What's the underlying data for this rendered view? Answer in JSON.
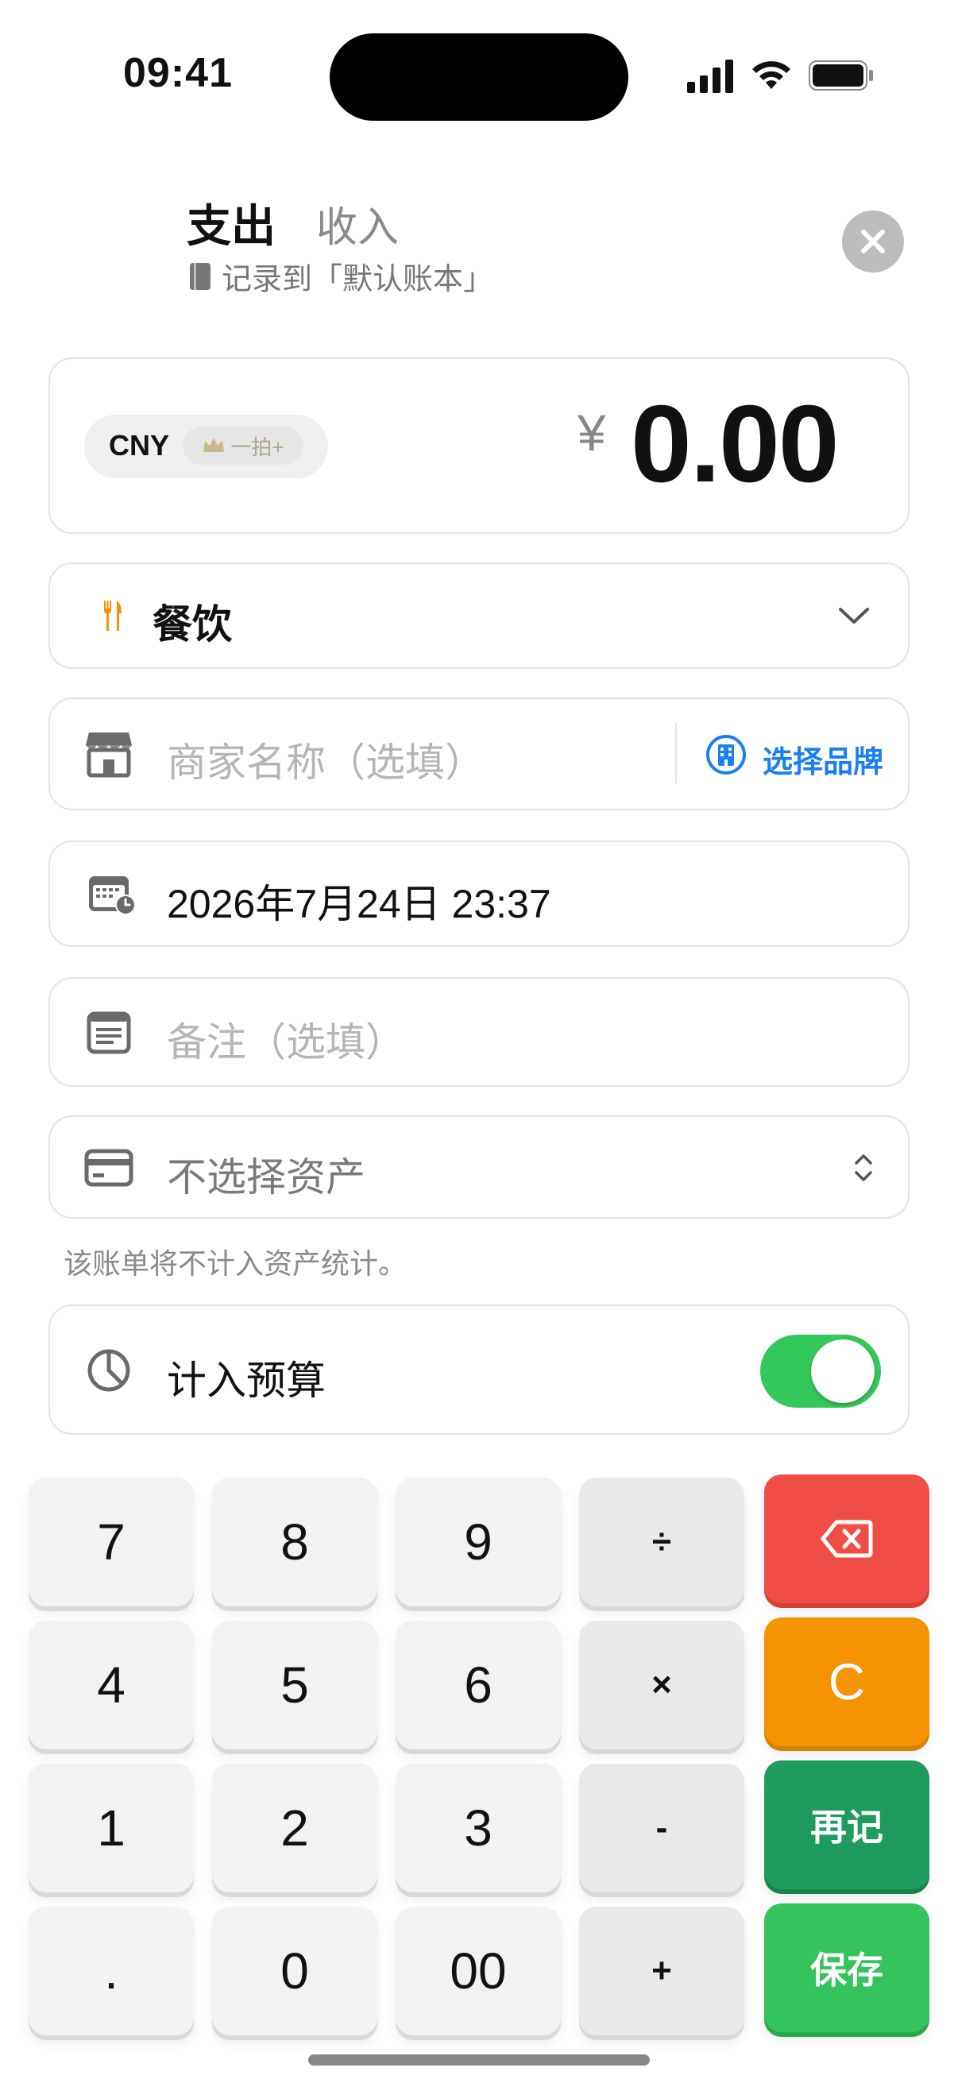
{
  "status_bar": {
    "time": "09:41"
  },
  "header": {
    "tab_expense": "支出",
    "tab_income": "收入",
    "record_to": "记录到「默认账本」"
  },
  "amount": {
    "currency": "CNY",
    "premium_badge": "一拍+",
    "symbol": "¥",
    "value": "0.00"
  },
  "category": {
    "label": "餐饮",
    "icon": "fork-knife-icon",
    "color": "#f59300"
  },
  "merchant": {
    "placeholder": "商家名称（选填）",
    "brand_button": "选择品牌"
  },
  "date": {
    "value": "2026年7月24日 23:37"
  },
  "note": {
    "placeholder": "备注（选填）"
  },
  "asset": {
    "label": "不选择资产",
    "hint": "该账单将不计入资产统计。"
  },
  "budget": {
    "label": "计入预算",
    "enabled": true
  },
  "keypad": {
    "row1": [
      "7",
      "8",
      "9",
      "÷"
    ],
    "row2": [
      "4",
      "5",
      "6",
      "×"
    ],
    "row3": [
      "1",
      "2",
      "3",
      "-"
    ],
    "row4": [
      ".",
      "0",
      "00",
      "+"
    ],
    "clear": "C",
    "again": "再记",
    "save": "保存"
  },
  "colors": {
    "accent_blue": "#1a7ff0",
    "toggle_on": "#34c759",
    "delete_red": "#f04e45",
    "clear_orange": "#f59300",
    "again_green": "#1f9b5f",
    "save_green": "#35c35c"
  }
}
